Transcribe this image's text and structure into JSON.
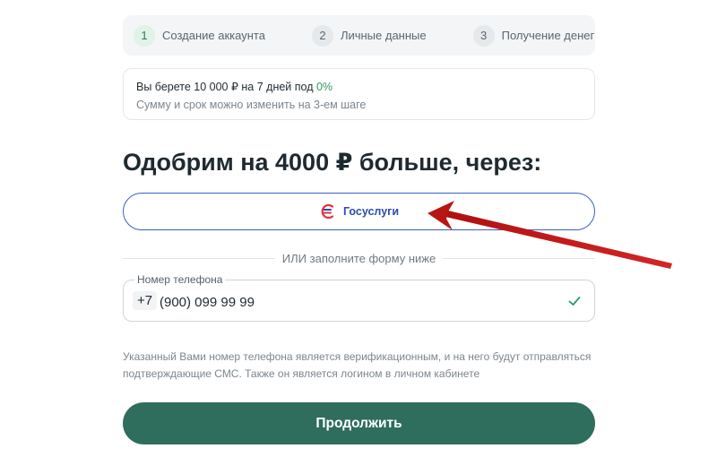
{
  "steps": [
    {
      "num": "1",
      "label": "Создание аккаунта",
      "active": true
    },
    {
      "num": "2",
      "label": "Личные данные",
      "active": false
    },
    {
      "num": "3",
      "label": "Получение денег",
      "active": false
    }
  ],
  "info": {
    "line1_prefix": "Вы берете 10 000 ₽ на 7 дней под ",
    "line1_rate": "0%",
    "line2": "Сумму и срок можно изменить на 3-ем шаге"
  },
  "heading": "Одобрим на 4000 ₽ больше, через:",
  "gosuslugi_button": {
    "label": "Госуслуги"
  },
  "divider_text": "ИЛИ заполните форму ниже",
  "phone": {
    "label": "Номер телефона",
    "prefix": "+7",
    "value": "(900) 099 99 99"
  },
  "note": "Указанный Вами номер телефона является верификационным, и на него будут отправляться подтверждающие СМС. Также он является логином в личном кабинете",
  "continue_button": {
    "label": "Продолжить"
  },
  "colors": {
    "accent_green": "#2f6d5d",
    "check_green": "#2f9a64",
    "gos_blue": "#2b4cb4",
    "gos_red": "#e5333a",
    "arrow_red": "#c01a1a"
  },
  "icons": {
    "gosuslugi": "gosuslugi-logo-icon",
    "check": "check-icon"
  }
}
